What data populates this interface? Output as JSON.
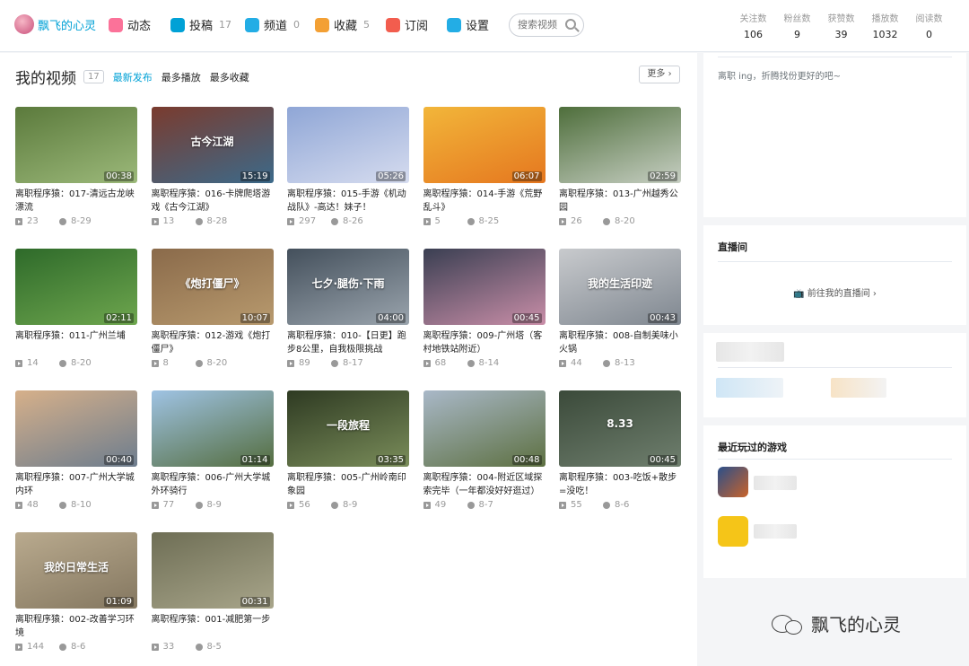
{
  "brand": {
    "name": "飘飞的心灵"
  },
  "nav": [
    {
      "label": "动态",
      "count": "",
      "icon": "dynamic-icon",
      "color": "#fb7299"
    },
    {
      "label": "投稿",
      "count": "17",
      "icon": "upload-icon",
      "color": "#00a1d6"
    },
    {
      "label": "频道",
      "count": "0",
      "icon": "channel-icon",
      "color": "#23ade5"
    },
    {
      "label": "收藏",
      "count": "5",
      "icon": "star-icon",
      "color": "#f3a034"
    },
    {
      "label": "订阅",
      "count": "",
      "icon": "heart-icon",
      "color": "#f25d4e"
    },
    {
      "label": "设置",
      "count": "",
      "icon": "gear-icon",
      "color": "#23ade5"
    }
  ],
  "search": {
    "placeholder": "搜索视频"
  },
  "stats": [
    {
      "label": "关注数",
      "value": "106"
    },
    {
      "label": "粉丝数",
      "value": "9"
    },
    {
      "label": "获赞数",
      "value": "39"
    },
    {
      "label": "播放数",
      "value": "1032"
    },
    {
      "label": "阅读数",
      "value": "0"
    }
  ],
  "section": {
    "title": "我的视频",
    "count": "17",
    "tabs": [
      "最新发布",
      "最多播放",
      "最多收藏"
    ],
    "more": "更多"
  },
  "videos": [
    {
      "title": "离职程序猿：017-清远古龙峡漂流",
      "duration": "00:38",
      "plays": "23",
      "date": "8-29"
    },
    {
      "title": "离职程序猿：016-卡牌爬塔游戏《古今江湖》",
      "duration": "15:19",
      "plays": "13",
      "date": "8-28"
    },
    {
      "title": "离职程序猿：015-手游《机动战队》-高达！妹子！",
      "duration": "05:26",
      "plays": "297",
      "date": "8-26"
    },
    {
      "title": "离职程序猿：014-手游《荒野乱斗》",
      "duration": "06:07",
      "plays": "5",
      "date": "8-25"
    },
    {
      "title": "离职程序猿：013-广州越秀公园",
      "duration": "02:59",
      "plays": "26",
      "date": "8-20"
    },
    {
      "title": "离职程序猿：011-广州兰埔",
      "duration": "02:11",
      "plays": "14",
      "date": "8-20"
    },
    {
      "title": "离职程序猿：012-游戏《炮打僵尸》",
      "duration": "10:07",
      "plays": "8",
      "date": "8-20"
    },
    {
      "title": "离职程序猿：010-【日更】跑步8公里，自我极限挑战",
      "duration": "04:00",
      "plays": "89",
      "date": "8-17"
    },
    {
      "title": "离职程序猿：009-广州塔（客村地铁站附近）",
      "duration": "00:45",
      "plays": "68",
      "date": "8-14"
    },
    {
      "title": "离职程序猿：008-自制美味小火锅",
      "duration": "00:43",
      "plays": "44",
      "date": "8-13"
    },
    {
      "title": "离职程序猿：007-广州大学城内环",
      "duration": "00:40",
      "plays": "48",
      "date": "8-10"
    },
    {
      "title": "离职程序猿：006-广州大学城外环骑行",
      "duration": "01:14",
      "plays": "77",
      "date": "8-9"
    },
    {
      "title": "离职程序猿：005-广州岭南印象园",
      "duration": "03:35",
      "plays": "56",
      "date": "8-9"
    },
    {
      "title": "离职程序猿：004-附近区域探索完毕（一年都没好好逛过）",
      "duration": "00:48",
      "plays": "49",
      "date": "8-7"
    },
    {
      "title": "离职程序猿：003-吃饭+散步=没吃！",
      "duration": "00:45",
      "plays": "55",
      "date": "8-6"
    },
    {
      "title": "离职程序猿：002-改善学习环境",
      "duration": "01:09",
      "plays": "144",
      "date": "8-6"
    },
    {
      "title": "离职程序猿：001-减肥第一步",
      "duration": "00:31",
      "plays": "33",
      "date": "8-5"
    }
  ],
  "thumb_overlays": {
    "1": "古今江湖",
    "6": "《炮打僵尸》",
    "7": "七夕·腿伤·下雨",
    "9": "我的生活印迹",
    "12": "一段旅程",
    "14": "8.33",
    "15": "我的日常生活"
  },
  "thumb_colors": [
    [
      "#5b7a3c",
      "#9cb97a"
    ],
    [
      "#7a3b2e",
      "#3c6a8a"
    ],
    [
      "#8fa6d6",
      "#d6dcef"
    ],
    [
      "#f2b63a",
      "#e5771f"
    ],
    [
      "#4e6e3b",
      "#c7cfc3"
    ],
    [
      "#2e6a2a",
      "#6ea64e"
    ],
    [
      "#8a6a4a",
      "#b89a6e"
    ],
    [
      "#44505c",
      "#9aa4ad"
    ],
    [
      "#3a3f52",
      "#c98ea8"
    ],
    [
      "#c8cacd",
      "#7f8790"
    ],
    [
      "#d6b08a",
      "#6d7d8e"
    ],
    [
      "#9fc3e4",
      "#546d3e"
    ],
    [
      "#2e3a22",
      "#7a8d5a"
    ],
    [
      "#a9b8c8",
      "#5d7041"
    ],
    [
      "#3b4a3a",
      "#6f7f6e"
    ],
    [
      "#b9aa8e",
      "#847760"
    ],
    [
      "#6e6e55",
      "#a8a58a"
    ]
  ],
  "right": {
    "bio": "离职 ing，折腾找份更好的吧~",
    "live_title": "直播间",
    "live_link": "前往我的直播间",
    "games_title": "最近玩过的游戏"
  },
  "watermark": "飘飞的心灵"
}
